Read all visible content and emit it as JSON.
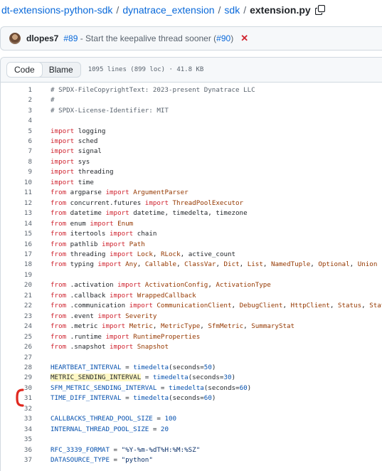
{
  "breadcrumb": {
    "repo": "dt-extensions-python-sdk",
    "sep": "/",
    "dir1": "dynatrace_extension",
    "dir2": "sdk",
    "file": "extension.py"
  },
  "commit": {
    "author": "dlopes7",
    "pr": "#89",
    "message": " - Start the keepalive thread sooner (",
    "pr_link": "#90",
    "message_end": ")",
    "status_symbol": "✕"
  },
  "file_header": {
    "code_tab": "Code",
    "blame_tab": "Blame",
    "meta": "1095 lines (899 loc) · 41.8 KB"
  },
  "colors": {
    "keyword": "#cf222e",
    "comment": "#59636e",
    "type": "#953800",
    "string": "#0a3069",
    "number": "#0550ae",
    "annotation_bracket": "#e0281f"
  },
  "code": [
    {
      "n": "1",
      "t": [
        [
          "cm",
          "# SPDX-FileCopyrightText: 2023-present Dynatrace LLC"
        ]
      ]
    },
    {
      "n": "2",
      "t": [
        [
          "cm",
          "#"
        ]
      ]
    },
    {
      "n": "3",
      "t": [
        [
          "cm",
          "# SPDX-License-Identifier: MIT"
        ]
      ]
    },
    {
      "n": "4",
      "t": []
    },
    {
      "n": "5",
      "t": [
        [
          "kw",
          "import"
        ],
        [
          "",
          " logging"
        ]
      ]
    },
    {
      "n": "6",
      "t": [
        [
          "kw",
          "import"
        ],
        [
          "",
          " sched"
        ]
      ]
    },
    {
      "n": "7",
      "t": [
        [
          "kw",
          "import"
        ],
        [
          "",
          " signal"
        ]
      ]
    },
    {
      "n": "8",
      "t": [
        [
          "kw",
          "import"
        ],
        [
          "",
          " sys"
        ]
      ]
    },
    {
      "n": "9",
      "t": [
        [
          "kw",
          "import"
        ],
        [
          "",
          " threading"
        ]
      ]
    },
    {
      "n": "10",
      "t": [
        [
          "kw",
          "import"
        ],
        [
          "",
          " time"
        ]
      ]
    },
    {
      "n": "11",
      "t": [
        [
          "kw",
          "from"
        ],
        [
          "",
          " argparse "
        ],
        [
          "kw",
          "import"
        ],
        [
          "ty",
          " ArgumentParser"
        ]
      ]
    },
    {
      "n": "12",
      "t": [
        [
          "kw",
          "from"
        ],
        [
          "",
          " concurrent.futures "
        ],
        [
          "kw",
          "import"
        ],
        [
          "ty",
          " ThreadPoolExecutor"
        ]
      ]
    },
    {
      "n": "13",
      "t": [
        [
          "kw",
          "from"
        ],
        [
          "",
          " datetime "
        ],
        [
          "kw",
          "import"
        ],
        [
          "",
          " datetime, timedelta, timezone"
        ]
      ]
    },
    {
      "n": "14",
      "t": [
        [
          "kw",
          "from"
        ],
        [
          "",
          " enum "
        ],
        [
          "kw",
          "import"
        ],
        [
          "ty",
          " Enum"
        ]
      ]
    },
    {
      "n": "15",
      "t": [
        [
          "kw",
          "from"
        ],
        [
          "",
          " itertools "
        ],
        [
          "kw",
          "import"
        ],
        [
          "",
          " chain"
        ]
      ]
    },
    {
      "n": "16",
      "t": [
        [
          "kw",
          "from"
        ],
        [
          "",
          " pathlib "
        ],
        [
          "kw",
          "import"
        ],
        [
          "ty",
          " Path"
        ]
      ]
    },
    {
      "n": "17",
      "t": [
        [
          "kw",
          "from"
        ],
        [
          "",
          " threading "
        ],
        [
          "kw",
          "import"
        ],
        [
          "ty",
          " Lock"
        ],
        [
          "",
          ", "
        ],
        [
          "ty",
          "RLock"
        ],
        [
          "",
          ", active_count"
        ]
      ]
    },
    {
      "n": "18",
      "t": [
        [
          "kw",
          "from"
        ],
        [
          "",
          " typing "
        ],
        [
          "kw",
          "import"
        ],
        [
          "ty",
          " Any"
        ],
        [
          "",
          ", "
        ],
        [
          "ty",
          "Callable"
        ],
        [
          "",
          ", "
        ],
        [
          "ty",
          "ClassVar"
        ],
        [
          "",
          ", "
        ],
        [
          "ty",
          "Dict"
        ],
        [
          "",
          ", "
        ],
        [
          "ty",
          "List"
        ],
        [
          "",
          ", "
        ],
        [
          "ty",
          "NamedTuple"
        ],
        [
          "",
          ", "
        ],
        [
          "ty",
          "Optional"
        ],
        [
          "",
          ", "
        ],
        [
          "ty",
          "Union"
        ]
      ]
    },
    {
      "n": "19",
      "t": []
    },
    {
      "n": "20",
      "t": [
        [
          "kw",
          "from"
        ],
        [
          "",
          " .activation "
        ],
        [
          "kw",
          "import"
        ],
        [
          "ty",
          " ActivationConfig"
        ],
        [
          "",
          ", "
        ],
        [
          "ty",
          "ActivationType"
        ]
      ]
    },
    {
      "n": "21",
      "t": [
        [
          "kw",
          "from"
        ],
        [
          "",
          " .callback "
        ],
        [
          "kw",
          "import"
        ],
        [
          "ty",
          " WrappedCallback"
        ]
      ]
    },
    {
      "n": "22",
      "t": [
        [
          "kw",
          "from"
        ],
        [
          "",
          " .communication "
        ],
        [
          "kw",
          "import"
        ],
        [
          "ty",
          " CommunicationClient"
        ],
        [
          "",
          ", "
        ],
        [
          "ty",
          "DebugClient"
        ],
        [
          "",
          ", "
        ],
        [
          "ty",
          "HttpClient"
        ],
        [
          "",
          ", "
        ],
        [
          "ty",
          "Status"
        ],
        [
          "",
          ", "
        ],
        [
          "ty",
          "StatusValue"
        ]
      ]
    },
    {
      "n": "23",
      "t": [
        [
          "kw",
          "from"
        ],
        [
          "",
          " .event "
        ],
        [
          "kw",
          "import"
        ],
        [
          "ty",
          " Severity"
        ]
      ]
    },
    {
      "n": "24",
      "t": [
        [
          "kw",
          "from"
        ],
        [
          "",
          " .metric "
        ],
        [
          "kw",
          "import"
        ],
        [
          "ty",
          " Metric"
        ],
        [
          "",
          ", "
        ],
        [
          "ty",
          "MetricType"
        ],
        [
          "",
          ", "
        ],
        [
          "ty",
          "SfmMetric"
        ],
        [
          "",
          ", "
        ],
        [
          "ty",
          "SummaryStat"
        ]
      ]
    },
    {
      "n": "25",
      "t": [
        [
          "kw",
          "from"
        ],
        [
          "",
          " .runtime "
        ],
        [
          "kw",
          "import"
        ],
        [
          "ty",
          " RuntimeProperties"
        ]
      ]
    },
    {
      "n": "26",
      "t": [
        [
          "kw",
          "from"
        ],
        [
          "",
          " .snapshot "
        ],
        [
          "kw",
          "import"
        ],
        [
          "ty",
          " Snapshot"
        ]
      ]
    },
    {
      "n": "27",
      "t": []
    },
    {
      "n": "28",
      "t": [
        [
          "var",
          "HEARTBEAT_INTERVAL"
        ],
        [
          "",
          " = "
        ],
        [
          "var",
          "timedelta"
        ],
        [
          "",
          "(seconds="
        ],
        [
          "num",
          "50"
        ],
        [
          "",
          ")"
        ]
      ]
    },
    {
      "n": "29",
      "t": [
        [
          "hl",
          "METRIC_SENDING_INTERVAL"
        ],
        [
          "",
          " = "
        ],
        [
          "var",
          "timedelta"
        ],
        [
          "",
          "(seconds="
        ],
        [
          "num",
          "30"
        ],
        [
          "",
          ")"
        ]
      ]
    },
    {
      "n": "30",
      "t": [
        [
          "var",
          "SFM_METRIC_SENDING_INTERVAL"
        ],
        [
          "",
          " = "
        ],
        [
          "var",
          "timedelta"
        ],
        [
          "",
          "(seconds="
        ],
        [
          "num",
          "60"
        ],
        [
          "",
          ")"
        ]
      ]
    },
    {
      "n": "31",
      "t": [
        [
          "var",
          "TIME_DIFF_INTERVAL"
        ],
        [
          "",
          " = "
        ],
        [
          "var",
          "timedelta"
        ],
        [
          "",
          "(seconds="
        ],
        [
          "num",
          "60"
        ],
        [
          "",
          ")"
        ]
      ]
    },
    {
      "n": "32",
      "t": []
    },
    {
      "n": "33",
      "t": [
        [
          "var",
          "CALLBACKS_THREAD_POOL_SIZE"
        ],
        [
          "",
          " = "
        ],
        [
          "num",
          "100"
        ]
      ]
    },
    {
      "n": "34",
      "t": [
        [
          "var",
          "INTERNAL_THREAD_POOL_SIZE"
        ],
        [
          "",
          " = "
        ],
        [
          "num",
          "20"
        ]
      ]
    },
    {
      "n": "35",
      "t": []
    },
    {
      "n": "36",
      "t": [
        [
          "var",
          "RFC_3339_FORMAT"
        ],
        [
          "",
          " = "
        ],
        [
          "str",
          "\"%Y-%m-%dT%H:%M:%SZ\""
        ]
      ]
    },
    {
      "n": "37",
      "t": [
        [
          "var",
          "DATASOURCE_TYPE"
        ],
        [
          "",
          " = "
        ],
        [
          "str",
          "\"python\""
        ]
      ]
    }
  ]
}
